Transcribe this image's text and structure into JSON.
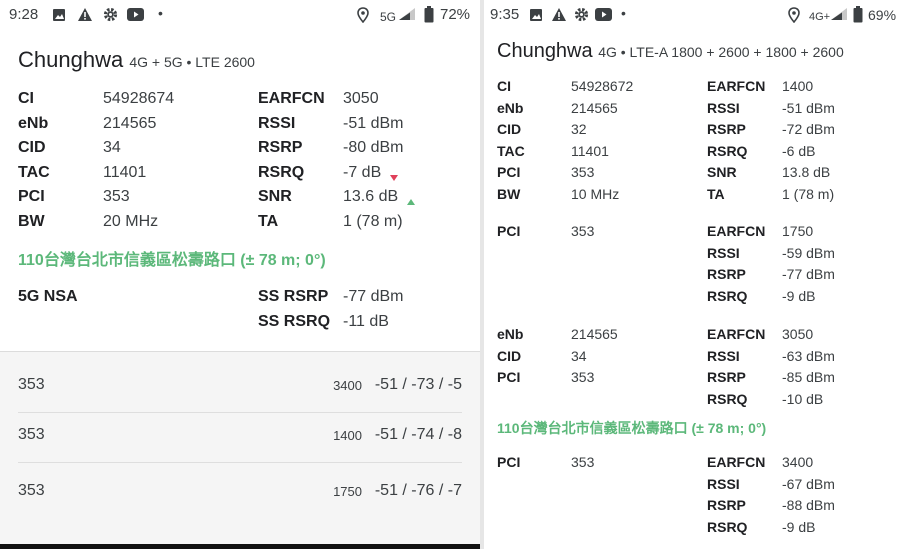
{
  "left": {
    "status": {
      "time": "9:28",
      "dot": "•",
      "network": "5G",
      "battery": "72%"
    },
    "header": {
      "operator": "Chunghwa",
      "tech": "4G + 5G • LTE 2600"
    },
    "cell": [
      {
        "l": "CI",
        "v": "54928674",
        "l2": "EARFCN",
        "v2": "3050"
      },
      {
        "l": "eNb",
        "v": "214565",
        "l2": "RSSI",
        "v2": "-51 dBm"
      },
      {
        "l": "CID",
        "v": "34",
        "l2": "RSRP",
        "v2": "-80 dBm"
      },
      {
        "l": "TAC",
        "v": "11401",
        "l2": "RSRQ",
        "v2": "-7 dB"
      },
      {
        "l": "PCI",
        "v": "353",
        "l2": "SNR",
        "v2": "13.6 dB"
      },
      {
        "l": "BW",
        "v": "20 MHz",
        "l2": "TA",
        "v2": "1 (78 m)"
      }
    ],
    "location": "110台灣台北市信義區松壽路口 (± 78 m; 0°)",
    "nsa": {
      "label": "5G NSA",
      "rsrp_label": "SS RSRP",
      "rsrp": "-77 dBm",
      "rsrq_label": "SS RSRQ",
      "rsrq": "-11 dB"
    },
    "neighbors": [
      {
        "pci": "353",
        "ch": "3400",
        "sig": "-51 / -73 / -5"
      },
      {
        "pci": "353",
        "ch": "1400",
        "sig": "-51 / -74 / -8"
      },
      {
        "pci": "353",
        "ch": "1750",
        "sig": "-51 / -76 / -7"
      }
    ],
    "colors": {
      "accent": "#5cb87a",
      "down": "#e0405a",
      "up": "#5cb87a"
    }
  },
  "right": {
    "status": {
      "time": "9:35",
      "dot": "•",
      "network": "4G+",
      "battery": "69%"
    },
    "header": {
      "operator": "Chunghwa",
      "tech": "4G • LTE-A 1800 + 2600 + 1800 + 2600"
    },
    "cell": [
      {
        "l": "CI",
        "v": "54928672",
        "l2": "EARFCN",
        "v2": "1400"
      },
      {
        "l": "eNb",
        "v": "214565",
        "l2": "RSSI",
        "v2": "-51 dBm"
      },
      {
        "l": "CID",
        "v": "32",
        "l2": "RSRP",
        "v2": "-72 dBm"
      },
      {
        "l": "TAC",
        "v": "11401",
        "l2": "RSRQ",
        "v2": "-6 dB"
      },
      {
        "l": "PCI",
        "v": "353",
        "l2": "SNR",
        "v2": "13.8 dB"
      },
      {
        "l": "BW",
        "v": "10 MHz",
        "l2": "TA",
        "v2": "1 (78 m)"
      }
    ],
    "ca1": [
      {
        "l": "PCI",
        "v": "353",
        "l2": "EARFCN",
        "v2": "1750"
      },
      {
        "l": "",
        "v": "",
        "l2": "RSSI",
        "v2": "-59 dBm"
      },
      {
        "l": "",
        "v": "",
        "l2": "RSRP",
        "v2": "-77 dBm"
      },
      {
        "l": "",
        "v": "",
        "l2": "RSRQ",
        "v2": "-9 dB"
      }
    ],
    "ca2": [
      {
        "l": "eNb",
        "v": "214565",
        "l2": "EARFCN",
        "v2": "3050"
      },
      {
        "l": "CID",
        "v": "34",
        "l2": "RSSI",
        "v2": "-63 dBm"
      },
      {
        "l": "PCI",
        "v": "353",
        "l2": "RSRP",
        "v2": "-85 dBm"
      },
      {
        "l": "",
        "v": "",
        "l2": "RSRQ",
        "v2": "-10 dB"
      }
    ],
    "location": "110台灣台北市信義區松壽路口 (± 78 m; 0°)",
    "ca3": [
      {
        "l": "PCI",
        "v": "353",
        "l2": "EARFCN",
        "v2": "3400"
      },
      {
        "l": "",
        "v": "",
        "l2": "RSSI",
        "v2": "-67 dBm"
      },
      {
        "l": "",
        "v": "",
        "l2": "RSRP",
        "v2": "-88 dBm"
      },
      {
        "l": "",
        "v": "",
        "l2": "RSRQ",
        "v2": "-9 dB"
      }
    ]
  }
}
